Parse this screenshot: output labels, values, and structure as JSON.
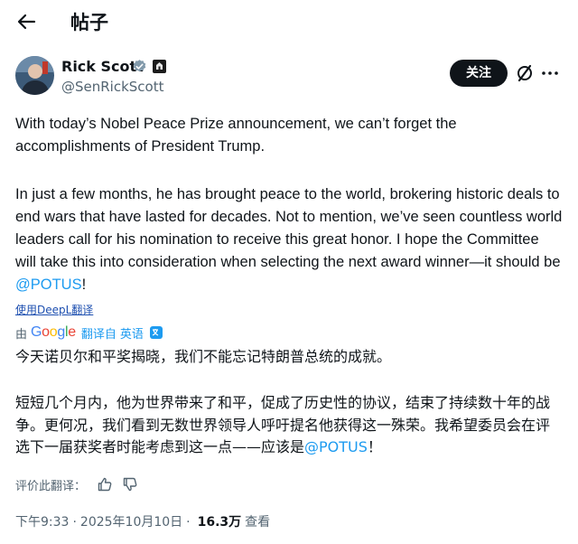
{
  "header": {
    "title": "帖子"
  },
  "author": {
    "name": "Rick Scott",
    "handle": "@SenRickScott"
  },
  "actions": {
    "follow_label": "关注"
  },
  "tweet": {
    "paragraph1": "With today’s Nobel Peace Prize announcement, we can’t forget the accomplishments of President Trump.",
    "paragraph2_before": "In just a few months, he has brought peace to the world, brokering historic deals to end wars that have lasted for decades. Not to mention, we’ve seen countless world leaders call for his nomination to receive this great honor. I hope the Committee will take this into consideration when selecting the next award winner—it should be ",
    "paragraph2_mention": "@POTUS",
    "paragraph2_after": "!"
  },
  "deepl_link": "使用DeepL翻译",
  "translation": {
    "by_label": "由",
    "google": [
      "G",
      "o",
      "o",
      "g",
      "l",
      "e"
    ],
    "translated_from": "翻译自",
    "source_language": "英语",
    "paragraph1": "今天诺贝尔和平奖揭晓，我们不能忘记特朗普总统的成就。",
    "paragraph2_before": "短短几个月内，他为世界带来了和平，促成了历史性的协议，结束了持续数十年的战争。更何况，我们看到无数世界领导人呼吁提名他获得这一殊荣。我希望委员会在评选下一届获奖者时能考虑到这一点——应该是",
    "paragraph2_mention": "@POTUS",
    "paragraph2_after": "！"
  },
  "rating": {
    "label": "评价此翻译："
  },
  "meta": {
    "time": "下午9:33",
    "separator": "·",
    "date": "2025年10月10日",
    "separator2": "·",
    "views": "16.3万",
    "views_label": "查看"
  },
  "colors": {
    "accent": "#1d9bf0",
    "text": "#0f1419",
    "muted": "#536471",
    "follow_bg": "#0f1419"
  },
  "icons": [
    "back-arrow-icon",
    "verified-icon",
    "affiliate-badge-icon",
    "grok-icon",
    "more-icon",
    "google-translate-icon",
    "thumbs-up-icon",
    "thumbs-down-icon"
  ]
}
